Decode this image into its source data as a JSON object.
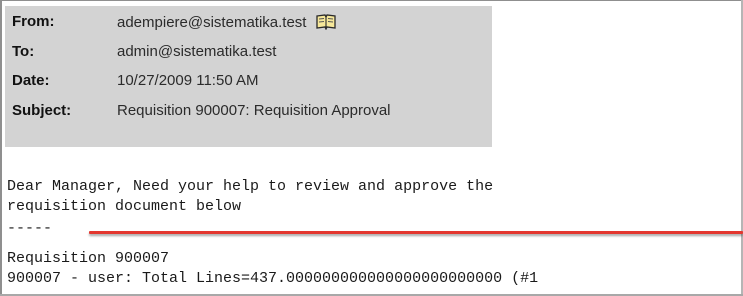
{
  "email": {
    "header": {
      "from_label": "From:",
      "from_value": "adempiere@sistematika.test",
      "to_label": "To:",
      "to_value": "admin@sistematika.test",
      "date_label": "Date:",
      "date_value": "10/27/2009 11:50 AM",
      "subject_label": "Subject:",
      "subject_value": "Requisition 900007: Requisition Approval",
      "address_book_icon": "address-book-icon"
    },
    "body": {
      "line1": "Dear Manager, Need your help to review and approve the",
      "line2": "requisition document below",
      "separator": "-----",
      "line4": "Requisition 900007",
      "line5": "900007 - user: Total Lines=437.000000000000000000000000 (#1"
    }
  }
}
